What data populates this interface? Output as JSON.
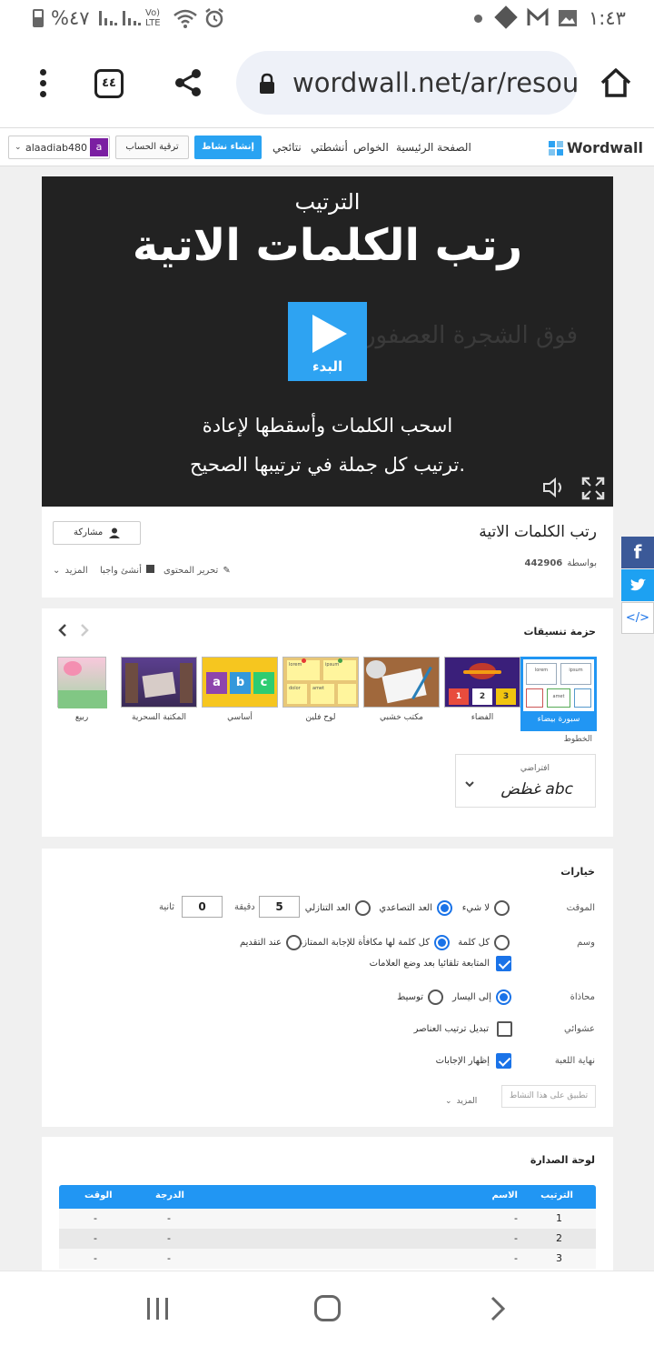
{
  "status_bar": {
    "battery": "%٤٧",
    "time": "١:٤٣",
    "network": "Vo) LTE"
  },
  "browser": {
    "url": "wordwall.net/ar/resou",
    "tab_count": "٤٤"
  },
  "header": {
    "logo": "Wordwall",
    "nav": [
      "الصفحة الرئيسية",
      "الخواص",
      "أنشطتي",
      "نتائجي"
    ],
    "create_button": "إنشاء نشاط",
    "upgrade_button": "ترقية الحساب",
    "username": "alaadiab480",
    "avatar_letter": "a"
  },
  "player": {
    "template_name": "الترتيب",
    "title": "رتب الكلمات الاتية",
    "background_words": "فوق الشجرة العصفور",
    "start_label": "البدء",
    "instruction_line1": "اسحب الكلمات وأسقطها لإعادة",
    "instruction_line2": "ترتيب كل جملة في ترتيبها الصحيح."
  },
  "activity": {
    "title": "رتب الكلمات الاتية",
    "by_label": "بواسطة",
    "author": "442906",
    "share_button": "مشاركة",
    "edit_content": "تحرير المحتوى",
    "make_homework": "أنشئ واجبا",
    "more": "المزيد"
  },
  "social": [
    "facebook-icon",
    "twitter-icon",
    "embed-icon"
  ],
  "theme_section": {
    "title": "حزمة تنسيقات",
    "themes": [
      "سبورة بيضاء",
      "الفضاء",
      "مكتب خشبي",
      "لوح فلين",
      "أساسي",
      "المكتبة السحرية",
      "ربيع"
    ],
    "selected_index": 0,
    "whiteboard_cells": [
      "lorem",
      "ipsum",
      "amet"
    ],
    "space_numbers": [
      "1",
      "2",
      "3"
    ],
    "basic_letters": [
      "a",
      "b",
      "c"
    ],
    "cork_words": [
      "lorem",
      "ipsum",
      "dolor",
      "amet"
    ],
    "fonts_label": "الخطوط",
    "font_default": "افتراضي",
    "font_sample": "غظض abc"
  },
  "options": {
    "title": "خيارات",
    "timer_label": "الموقت",
    "timer_options": [
      "لا شيء",
      "العد التصاعدي",
      "العد التنازلي"
    ],
    "timer_selected": 1,
    "minutes_value": "5",
    "minutes_label": "دقيقة",
    "seconds_value": "0",
    "seconds_label": "ثانية",
    "mark_label": "وسم",
    "mark_options": [
      "كل كلمة",
      "كل كلمة لها مكافأة للإجابة الممتازة",
      "عند التقديم"
    ],
    "mark_selected": 1,
    "auto_continue": "المتابعة تلقائيا بعد وضع العلامات",
    "align_label": "محاذاة",
    "align_options": [
      "إلى اليسار",
      "توسيط"
    ],
    "align_selected": 0,
    "random_label": "عشوائي",
    "shuffle_label": "تبديل ترتيب العناصر",
    "end_label": "نهاية اللعبة",
    "show_answers": "إظهار الإجابات",
    "more": "المزيد",
    "apply_button": "تطبيق على هذا النشاط"
  },
  "leaderboard": {
    "title": "لوحة الصدارة",
    "columns": [
      "الترتيب",
      "الاسم",
      "الدرجة",
      "الوقت"
    ],
    "rows": [
      [
        "1",
        "-",
        "-",
        "-"
      ],
      [
        "2",
        "-",
        "-",
        "-"
      ],
      [
        "3",
        "-",
        "-",
        "-"
      ]
    ]
  },
  "colors": {
    "accent": "#1a73e8",
    "theme_selected": "#2196f3",
    "player_bg": "#222222",
    "play_button": "#2ea3f2"
  }
}
